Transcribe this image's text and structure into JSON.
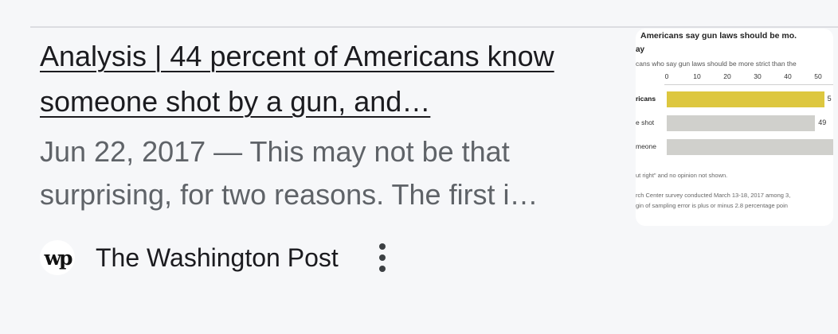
{
  "result": {
    "title": "Analysis | 44 percent of Americans know someone shot by a gun, and…",
    "snippet": "Jun 22, 2017 — This may not be that surprising, for two reasons. The first i…",
    "source": {
      "name": "The Washington Post",
      "favicon_text": "wp",
      "favicon_icon": "washington-post-logo-icon"
    },
    "more_icon": "three-dots-vertical-icon"
  },
  "thumbnail": {
    "title_line1": "Americans say gun laws should be mo.",
    "title_line2": "ay",
    "subtitle": "cans who say gun laws should be more strict than the",
    "ticks": [
      "0",
      "10",
      "20",
      "30",
      "40",
      "50"
    ],
    "rows": [
      {
        "label": "ricans",
        "value_label": "5",
        "bold": true
      },
      {
        "label": "e shot",
        "value_label": "49",
        "bold": false
      },
      {
        "label": "meone",
        "value_label": "",
        "bold": false
      }
    ],
    "notes": [
      "ut right\" and no opinion not shown.",
      "rch Center survey conducted March 13-18, 2017 among 3,",
      "gin of sampling error is plus or minus 2.8 percentage poin"
    ]
  },
  "chart_data": {
    "type": "bar",
    "title": "Americans say gun laws should be mo.",
    "categories": [
      "ricans",
      "e shot",
      "meone"
    ],
    "values": [
      52,
      49,
      55
    ],
    "xlim": [
      0,
      55
    ],
    "colors": [
      "#ddc73f",
      "#d0d0cc",
      "#d0d0cc"
    ]
  }
}
